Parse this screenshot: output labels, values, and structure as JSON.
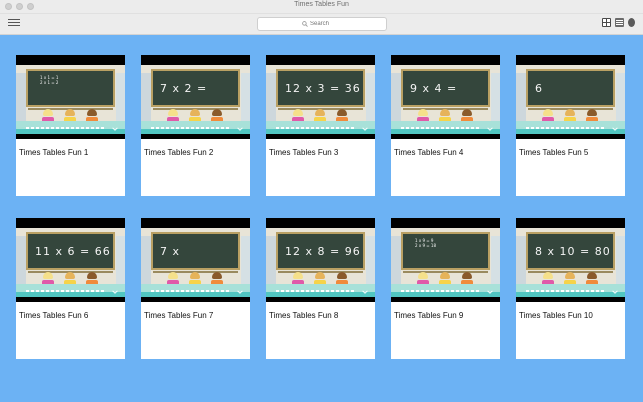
{
  "window": {
    "title": "Times Tables Fun"
  },
  "toolbar": {
    "search_placeholder": "Search"
  },
  "videos": [
    {
      "title": "Times Tables Fun 1",
      "board": "1 x 1 = 1\n2 x 1 = 2",
      "board_style": "small"
    },
    {
      "title": "Times Tables Fun 2",
      "board": "7 x 2 =",
      "board_style": "large"
    },
    {
      "title": "Times Tables Fun 3",
      "board": "12 x 3 = 36",
      "board_style": "large"
    },
    {
      "title": "Times Tables Fun 4",
      "board": "9 x 4 =",
      "board_style": "large"
    },
    {
      "title": "Times Tables Fun 5",
      "board": "6",
      "board_style": "large"
    },
    {
      "title": "Times Tables Fun 6",
      "board": "11 x 6 = 66",
      "board_style": "large"
    },
    {
      "title": "Times Tables Fun 7",
      "board": "7 x",
      "board_style": "large"
    },
    {
      "title": "Times Tables Fun 8",
      "board": "12 x 8 = 96",
      "board_style": "large"
    },
    {
      "title": "Times Tables Fun 9",
      "board": "1 x 9 = 9\n2 x 9 = 18",
      "board_style": "small"
    },
    {
      "title": "Times Tables Fun 10",
      "board": "8 x 10 = 80",
      "board_style": "large"
    }
  ],
  "icons": {
    "menu": "hamburger-menu-icon",
    "search": "magnifier-icon",
    "grid_view": "grid-view-icon",
    "list_view": "list-view-icon",
    "info": "info-icon"
  },
  "colors": {
    "background": "#6cb2f4",
    "chalkboard": "#34463c",
    "board_frame": "#b9a063",
    "desk": "#a8e1d9",
    "floor": "#51c6c1"
  }
}
